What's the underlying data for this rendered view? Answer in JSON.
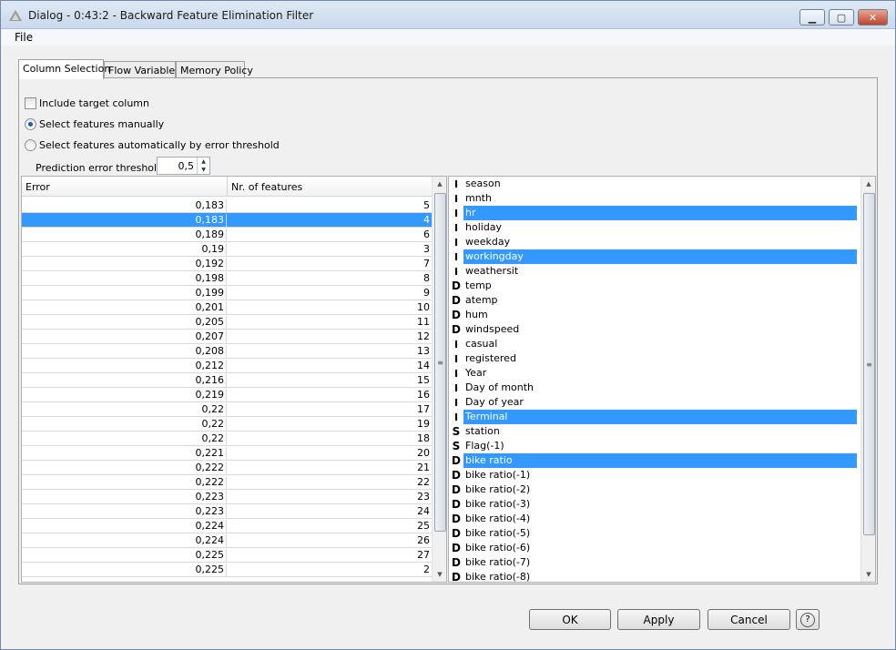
{
  "window": {
    "title": "Dialog - 0:43:2 - Backward Feature Elimination Filter",
    "minimize_glyph": "▁",
    "maximize_glyph": "▢",
    "close_glyph": "✕"
  },
  "menu": {
    "file": "File"
  },
  "tabs": [
    {
      "label": "Column Selection",
      "active": true
    },
    {
      "label": "Flow Variables",
      "active": false
    },
    {
      "label": "Memory Policy",
      "active": false
    }
  ],
  "options": {
    "include_target": "Include target column",
    "manual": "Select features manually",
    "automatic": "Select features automatically by error threshold",
    "threshold_label": "Prediction error threshold",
    "threshold_value": "0,5"
  },
  "table": {
    "headers": {
      "error": "Error",
      "features": "Nr. of features"
    },
    "rows": [
      [
        "0,183",
        "5"
      ],
      [
        "0,183",
        "4"
      ],
      [
        "0,189",
        "6"
      ],
      [
        "0,19",
        "3"
      ],
      [
        "0,192",
        "7"
      ],
      [
        "0,198",
        "8"
      ],
      [
        "0,199",
        "9"
      ],
      [
        "0,201",
        "10"
      ],
      [
        "0,205",
        "11"
      ],
      [
        "0,207",
        "12"
      ],
      [
        "0,208",
        "13"
      ],
      [
        "0,212",
        "14"
      ],
      [
        "0,216",
        "15"
      ],
      [
        "0,219",
        "16"
      ],
      [
        "0,22",
        "17"
      ],
      [
        "0,22",
        "19"
      ],
      [
        "0,22",
        "18"
      ],
      [
        "0,221",
        "20"
      ],
      [
        "0,222",
        "21"
      ],
      [
        "0,222",
        "22"
      ],
      [
        "0,223",
        "23"
      ],
      [
        "0,223",
        "24"
      ],
      [
        "0,224",
        "25"
      ],
      [
        "0,224",
        "26"
      ],
      [
        "0,225",
        "27"
      ],
      [
        "0,225",
        "2"
      ]
    ],
    "selected_row": 1
  },
  "columns": [
    {
      "type": "I",
      "name": "season",
      "selected": false
    },
    {
      "type": "I",
      "name": "mnth",
      "selected": false
    },
    {
      "type": "I",
      "name": "hr",
      "selected": true
    },
    {
      "type": "I",
      "name": "holiday",
      "selected": false
    },
    {
      "type": "I",
      "name": "weekday",
      "selected": false
    },
    {
      "type": "I",
      "name": "workingday",
      "selected": true
    },
    {
      "type": "I",
      "name": "weathersit",
      "selected": false
    },
    {
      "type": "D",
      "name": "temp",
      "selected": false
    },
    {
      "type": "D",
      "name": "atemp",
      "selected": false
    },
    {
      "type": "D",
      "name": "hum",
      "selected": false
    },
    {
      "type": "D",
      "name": "windspeed",
      "selected": false
    },
    {
      "type": "I",
      "name": "casual",
      "selected": false
    },
    {
      "type": "I",
      "name": "registered",
      "selected": false
    },
    {
      "type": "I",
      "name": "Year",
      "selected": false
    },
    {
      "type": "I",
      "name": "Day of month",
      "selected": false
    },
    {
      "type": "I",
      "name": "Day of year",
      "selected": false
    },
    {
      "type": "I",
      "name": "Terminal",
      "selected": true
    },
    {
      "type": "S",
      "name": "station",
      "selected": false
    },
    {
      "type": "S",
      "name": "Flag(-1)",
      "selected": false
    },
    {
      "type": "D",
      "name": "bike ratio",
      "selected": true
    },
    {
      "type": "D",
      "name": "bike ratio(-1)",
      "selected": false
    },
    {
      "type": "D",
      "name": "bike ratio(-2)",
      "selected": false
    },
    {
      "type": "D",
      "name": "bike ratio(-3)",
      "selected": false
    },
    {
      "type": "D",
      "name": "bike ratio(-4)",
      "selected": false
    },
    {
      "type": "D",
      "name": "bike ratio(-5)",
      "selected": false
    },
    {
      "type": "D",
      "name": "bike ratio(-6)",
      "selected": false
    },
    {
      "type": "D",
      "name": "bike ratio(-7)",
      "selected": false
    },
    {
      "type": "D",
      "name": "bike ratio(-8)",
      "selected": false
    }
  ],
  "buttons": {
    "ok": "OK",
    "apply": "Apply",
    "cancel": "Cancel",
    "help": "?"
  },
  "colors": {
    "selection": "#3399ff"
  },
  "icons": {
    "scroll_up": "▲",
    "scroll_down": "▼",
    "grip": "≡",
    "spin_up": "▲",
    "spin_down": "▼"
  }
}
